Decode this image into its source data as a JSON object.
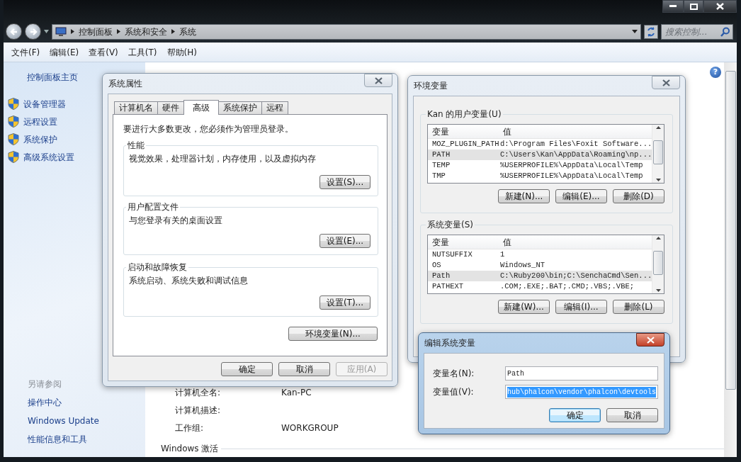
{
  "window": {
    "breadcrumbs": [
      "控制面板",
      "系统和安全",
      "系统"
    ],
    "search": {
      "placeholder": "搜索控制..."
    },
    "menu": [
      "文件(F)",
      "编辑(E)",
      "查看(V)",
      "工具(T)",
      "帮助(H)"
    ],
    "help": "?"
  },
  "sidebar": {
    "home": "控制面板主页",
    "tasks": [
      "设备管理器",
      "远程设置",
      "系统保护",
      "高级系统设置"
    ],
    "see_also_title": "另请参阅",
    "see_also": [
      "操作中心",
      "Windows Update",
      "性能信息和工具"
    ]
  },
  "computer_info": [
    {
      "label": "计算机全名:",
      "value": "Kan-PC"
    },
    {
      "label": "计算机描述:"
    },
    {
      "label": "工作组:",
      "value": "WORKGROUP"
    }
  ],
  "activation_title": "Windows 激活",
  "system_properties": {
    "title": "系统属性",
    "tabs": [
      {
        "label": "计算机名",
        "selected": false
      },
      {
        "label": "硬件",
        "selected": false
      },
      {
        "label": "高级",
        "selected": true
      },
      {
        "label": "系统保护",
        "selected": false
      },
      {
        "label": "远程",
        "selected": false
      }
    ],
    "notice": "要进行大多数更改，您必须作为管理员登录。",
    "groups": [
      {
        "title": "性能",
        "description": "视觉效果，处理器计划，内存使用，以及虚拟内存",
        "button": "设置(S)..."
      },
      {
        "title": "用户配置文件",
        "description": "与您登录有关的桌面设置",
        "button": "设置(E)..."
      },
      {
        "title": "启动和故障恢复",
        "description": "系统启动、系统失败和调试信息",
        "button": "设置(T)..."
      }
    ],
    "env_button": "环境变量(N)...",
    "buttons": [
      {
        "label": "确定",
        "disabled": false
      },
      {
        "label": "取消",
        "disabled": false
      },
      {
        "label": "应用(A)",
        "disabled": true
      }
    ]
  },
  "environment_variables": {
    "title": "环境变量",
    "lists": [
      {
        "title": "Kan 的用户变量(U)",
        "columns": [
          "变量",
          "值"
        ],
        "rows": [
          {
            "name": "MOZ_PLUGIN_PATH",
            "value": "d:\\Program Files\\Foxit Software...",
            "selected": false
          },
          {
            "name": "PATH",
            "value": "C:\\Users\\Kan\\AppData\\Roaming\\np...",
            "selected": true
          },
          {
            "name": "TEMP",
            "value": "%USERPROFILE%\\AppData\\Local\\Temp",
            "selected": false
          },
          {
            "name": "TMP",
            "value": "%USERPROFILE%\\AppData\\Local\\Temp",
            "selected": false
          }
        ],
        "buttons": [
          "新建(N)...",
          "编辑(E)...",
          "删除(D)"
        ]
      },
      {
        "title": "系统变量(S)",
        "columns": [
          "变量",
          "值"
        ],
        "rows": [
          {
            "name": "NUTSUFFIX",
            "value": "1",
            "selected": false
          },
          {
            "name": "OS",
            "value": "Windows_NT",
            "selected": false
          },
          {
            "name": "Path",
            "value": "C:\\Ruby200\\bin;C:\\SenchaCmd\\Sen...",
            "selected": true
          },
          {
            "name": "PATHEXT",
            "value": ".COM;.EXE;.BAT;.CMD;.VBS;.VBE;",
            "selected": false
          }
        ],
        "buttons": [
          "新建(W)...",
          "编辑(I)...",
          "删除(L)"
        ]
      }
    ]
  },
  "edit_variable": {
    "title": "编辑系统变量",
    "fields": [
      {
        "label": "变量名(N):",
        "value": "Path",
        "selected": false
      },
      {
        "label": "变量值(V):",
        "value": "hub\\phalcon\\vendor\\phalcon\\devtools",
        "selected": true
      }
    ],
    "buttons": [
      {
        "label": "确定",
        "default": true
      },
      {
        "label": "取消",
        "default": false
      }
    ]
  }
}
